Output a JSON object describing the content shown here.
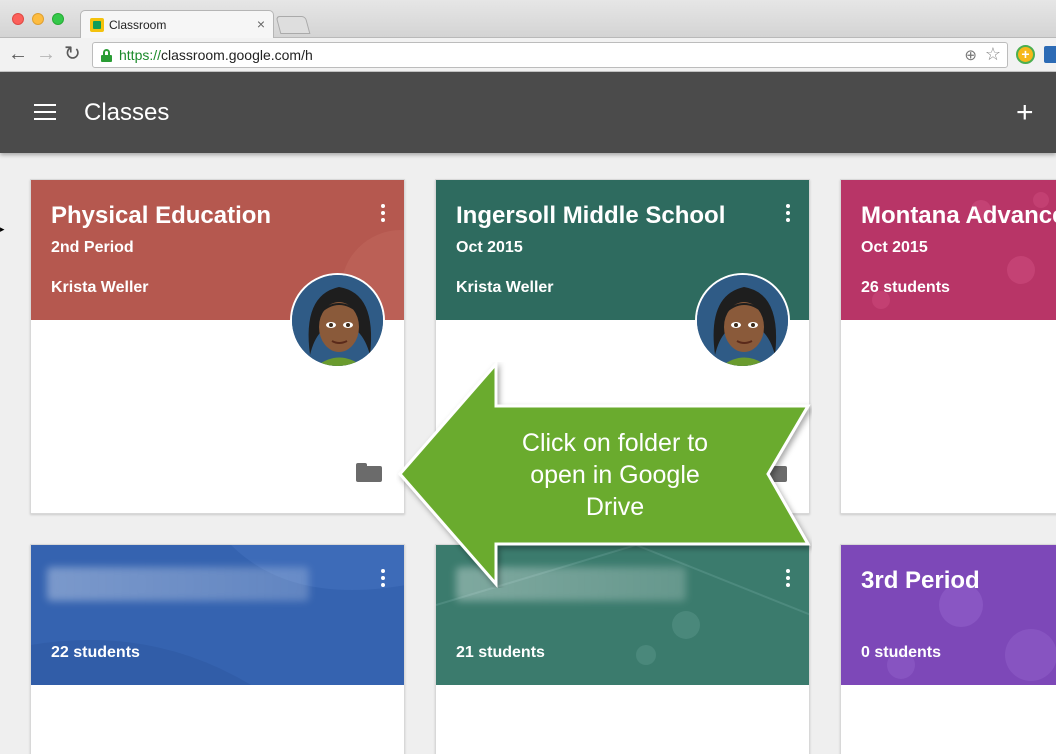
{
  "browser": {
    "tab_title": "Classroom",
    "tab_close": "×",
    "url_scheme": "https://",
    "url_rest": "classroom.google.com/h",
    "extension_label": "+"
  },
  "appbar": {
    "title": "Classes",
    "add_label": "+"
  },
  "classes": [
    {
      "title": "Physical Education",
      "subtitle": "2nd Period",
      "owner": "Krista Weller",
      "color": "#b5584f"
    },
    {
      "title": "Ingersoll Middle School",
      "subtitle": "Oct 2015",
      "owner": "Krista Weller",
      "color": "#2e6b5f"
    },
    {
      "title": "Montana Advance",
      "subtitle": "Oct 2015",
      "owner": "26 students",
      "color": "#b83567"
    },
    {
      "title": "",
      "subtitle": "",
      "owner": "22 students",
      "color": "#3563b0"
    },
    {
      "title": "",
      "subtitle": "",
      "owner": "21 students",
      "color": "#3b7b6d"
    },
    {
      "title": "3rd Period",
      "subtitle": "",
      "owner": "0 students",
      "color": "#7d48b8"
    }
  ],
  "callout": {
    "text": "Click on folder to open in Google Drive",
    "color": "#6aab2e"
  }
}
